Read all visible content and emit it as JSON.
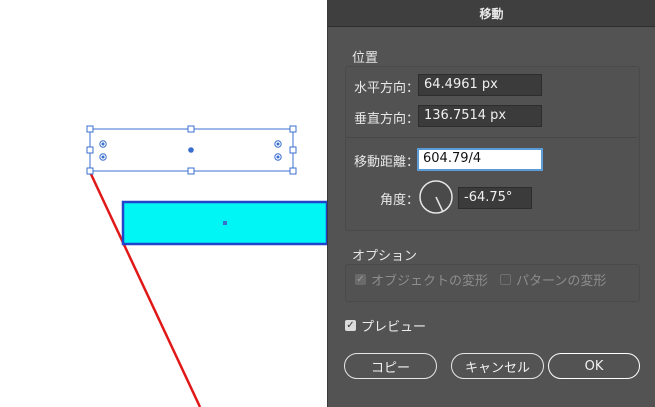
{
  "dialog": {
    "title": "移動",
    "position": {
      "title": "位置",
      "horizontal_label": "水平方向：",
      "horizontal_value": "64.4961 px",
      "vertical_label": "垂直方向：",
      "vertical_value": "136.7514 px",
      "distance_label": "移動距離：",
      "distance_value": "604.79/4",
      "angle_label": "角度：",
      "angle_value": "-64.75°"
    },
    "options": {
      "title": "オプション",
      "transform_objects_label": "オブジェクトの変形",
      "transform_objects_checked": true,
      "transform_patterns_label": "パターンの変形",
      "transform_patterns_checked": false
    },
    "preview_label": "プレビュー",
    "preview_checked": true,
    "buttons": {
      "copy": "コピー",
      "cancel": "キャンセル",
      "ok": "OK"
    }
  },
  "colors": {
    "cyan_rect": "#00f5f5",
    "rect_border": "#2244cc",
    "red_line": "#e01818",
    "selection": "#3a6fd0"
  }
}
